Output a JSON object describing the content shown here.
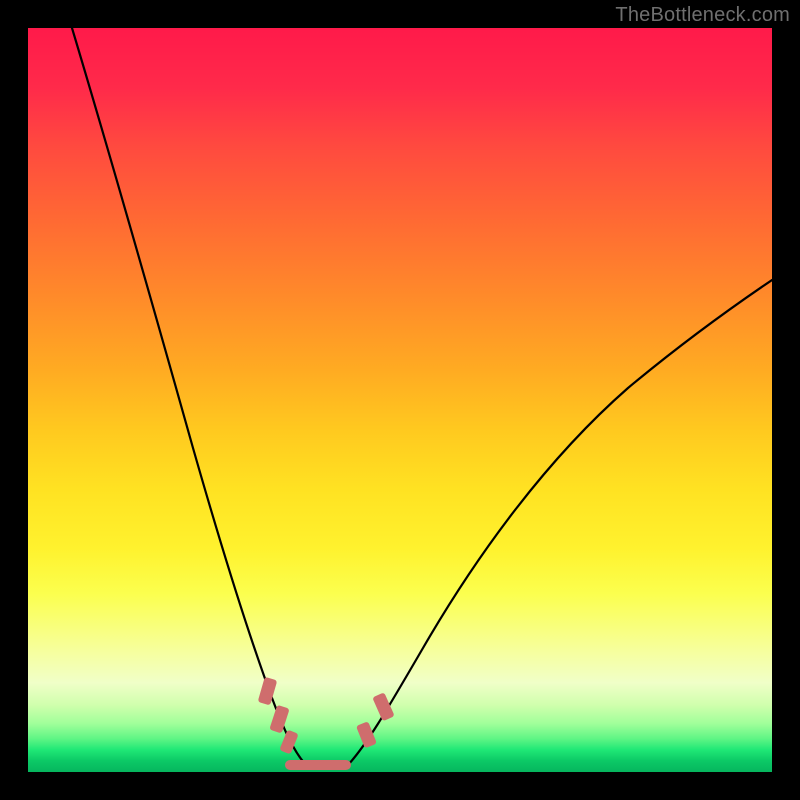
{
  "watermark": "TheBottleneck.com",
  "colors": {
    "background": "#000000",
    "curve": "#000000",
    "marker": "#cf6d6d"
  },
  "chart_data": {
    "type": "line",
    "title": "",
    "xlabel": "",
    "ylabel": "",
    "xlim": [
      0,
      100
    ],
    "ylim": [
      0,
      100
    ],
    "series": [
      {
        "name": "left-curve",
        "x": [
          0,
          5,
          10,
          15,
          20,
          25,
          28,
          30,
          32,
          34,
          35.5
        ],
        "y": [
          100,
          90,
          80,
          67,
          52,
          34,
          22,
          15,
          8,
          3,
          0.5
        ]
      },
      {
        "name": "right-curve",
        "x": [
          42,
          44,
          47,
          52,
          60,
          70,
          80,
          90,
          100
        ],
        "y": [
          0.5,
          4,
          10,
          20,
          33,
          46,
          55,
          62,
          67
        ]
      }
    ],
    "markers": {
      "left_pair_x": [
        30.5,
        32.5
      ],
      "right_pair_x": [
        44,
        46.5
      ],
      "floor_range_x": [
        34,
        42
      ],
      "y": 1
    },
    "gradient_stops": [
      {
        "pos": 0,
        "color": "#ff1a4a"
      },
      {
        "pos": 50,
        "color": "#ffd020"
      },
      {
        "pos": 80,
        "color": "#fcff70"
      },
      {
        "pos": 100,
        "color": "#06b65e"
      }
    ]
  }
}
